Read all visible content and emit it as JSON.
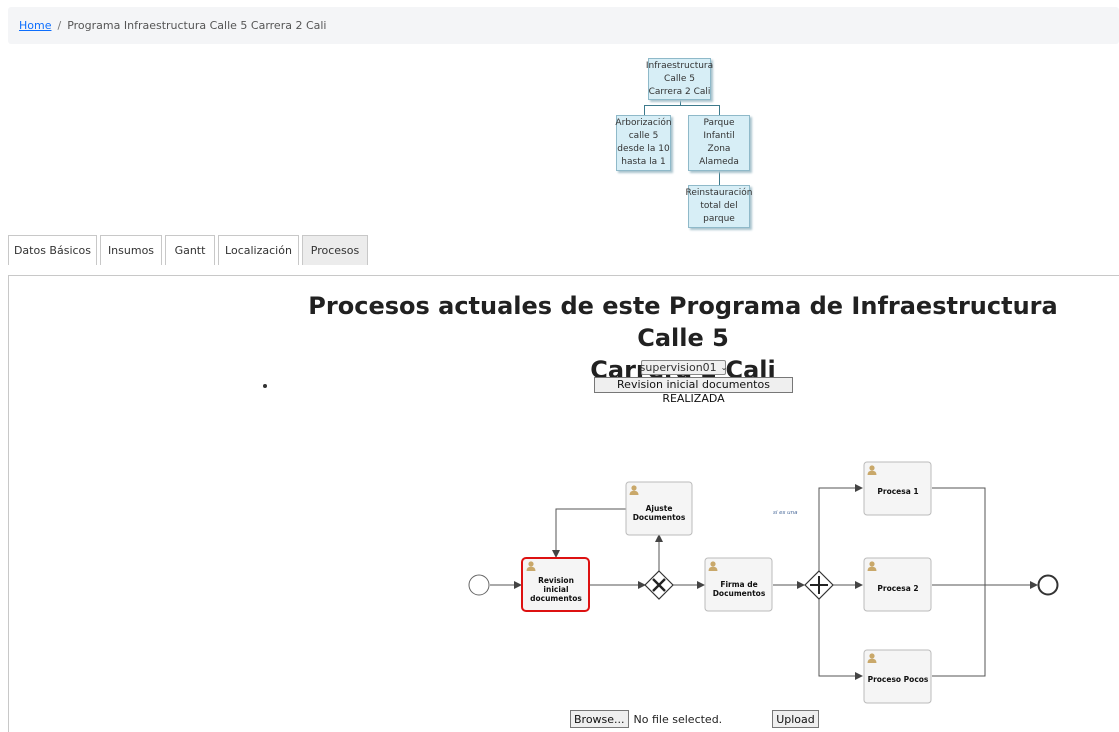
{
  "breadcrumb": {
    "home": "Home",
    "separator": "/",
    "current": "Programa Infraestructura Calle 5 Carrera 2 Cali"
  },
  "tree": {
    "root": [
      "Infraestructura",
      "Calle 5",
      "Carrera 2 Cali"
    ],
    "child1": [
      "Arborización",
      "calle 5",
      "desde la 10",
      "hasta la 1"
    ],
    "child2": [
      "Parque Infantil",
      "Zona Alameda"
    ],
    "grandchild": [
      "Reinstauración",
      "total del",
      "parque"
    ]
  },
  "tabs": [
    "Datos Básicos",
    "Insumos",
    "Gantt",
    "Localización",
    "Procesos"
  ],
  "process": {
    "title_line1": "Procesos actuales de este Programa de Infraestructura Calle 5",
    "title_line2": "Carrera 2 Cali",
    "select_value": "supervision01",
    "status_button": "Revision inicial documentos REALIZADA"
  },
  "bpmn": {
    "tasks": {
      "revision": [
        "Revision",
        "inicial",
        "documentos"
      ],
      "ajuste": [
        "Ajuste",
        "Documentos"
      ],
      "firma": [
        "Firma de",
        "Documentos"
      ],
      "procesa1": [
        "Procesa 1"
      ],
      "procesa2": [
        "Procesa 2"
      ],
      "pocos": [
        "Proceso Pocos"
      ]
    },
    "flow_label": "si es una",
    "colors": {
      "active_border": "#dd1111",
      "task_fill": "#f5f5f5",
      "user_icon": "#c9a86a"
    }
  },
  "upload": {
    "browse": "Browse...",
    "no_file": "No file selected.",
    "upload": "Upload"
  }
}
